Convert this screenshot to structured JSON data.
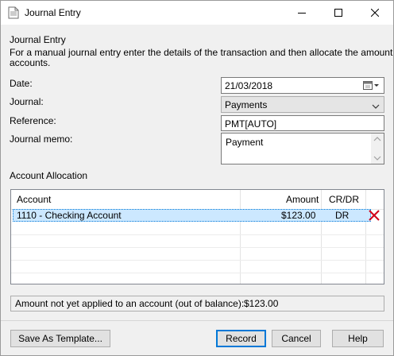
{
  "window": {
    "title": "Journal Entry"
  },
  "intro": {
    "heading": "Journal Entry",
    "description_line1": "For a manual journal entry enter the details of the transaction and then allocate the amount to",
    "description_line2": "accounts."
  },
  "form": {
    "date_label": "Date:",
    "date_value": "21/03/2018",
    "journal_label": "Journal:",
    "journal_value": "Payments",
    "reference_label": "Reference:",
    "reference_value": "PMT[AUTO]",
    "memo_label": "Journal memo:",
    "memo_value": "Payment"
  },
  "allocation": {
    "section_label": "Account Allocation",
    "columns": {
      "account": "Account",
      "amount": "Amount",
      "crdr": "CR/DR"
    },
    "rows": [
      {
        "account": "1110 - Checking Account",
        "amount": "$123.00",
        "crdr": "DR"
      }
    ]
  },
  "status": {
    "label": "Amount not yet applied to an account (out of balance):",
    "value": "$123.00"
  },
  "buttons": {
    "save_template": "Save As Template...",
    "record": "Record",
    "cancel": "Cancel",
    "help": "Help"
  },
  "icons": {
    "app": "document-icon",
    "calendar": "calendar-icon",
    "delete_row": "red-x-icon"
  },
  "colors": {
    "selection": "#cce8ff",
    "default_button_border": "#0078d7",
    "delete_x": "#d0021b"
  }
}
